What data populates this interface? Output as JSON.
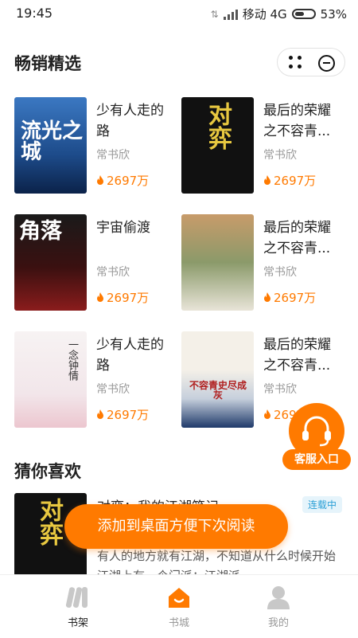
{
  "status": {
    "time": "19:45",
    "carrier": "移动 4G",
    "battery": "53%",
    "battery_level": 0.53
  },
  "bestsellers": {
    "title": "畅销精选",
    "books": [
      {
        "title": "少有人走的路",
        "author": "常书欣",
        "heat": "2697万",
        "cover_text": "流光之城"
      },
      {
        "title": "最后的荣耀之不容青...",
        "author": "常书欣",
        "heat": "2697万",
        "cover_text": "对弈"
      },
      {
        "title": "宇宙偷渡",
        "author": "常书欣",
        "heat": "2697万",
        "cover_text": "角落"
      },
      {
        "title": "最后的荣耀之不容青...",
        "author": "常书欣",
        "heat": "2697万",
        "cover_text": ""
      },
      {
        "title": "少有人走的路",
        "author": "常书欣",
        "heat": "2697万",
        "cover_text": "一念钟情"
      },
      {
        "title": "最后的荣耀之不容青...",
        "author": "常书欣",
        "heat": "2697万",
        "cover_text": "不容青史尽成灰"
      }
    ]
  },
  "guess": {
    "title": "猜你喜欢",
    "book_title": "对弈：我的江湖笔记",
    "badge": "连载中",
    "description": "有人的地方就有江湖，不知道从什么时候开始江湖上有一个门派：江湖派",
    "cover_text": "对弈"
  },
  "toast": {
    "text": "添加到桌面方便下次阅读"
  },
  "support": {
    "label": "客服入口"
  },
  "tabs": [
    {
      "label": "书架",
      "icon": "bookshelf-icon",
      "color": "#222222"
    },
    {
      "label": "书城",
      "icon": "home-icon",
      "color": "#999999",
      "active": true
    },
    {
      "label": "我的",
      "icon": "user-icon",
      "color": "#999999"
    }
  ],
  "colors": {
    "accent": "#ff7a00",
    "badge": "#2a9fd6"
  }
}
